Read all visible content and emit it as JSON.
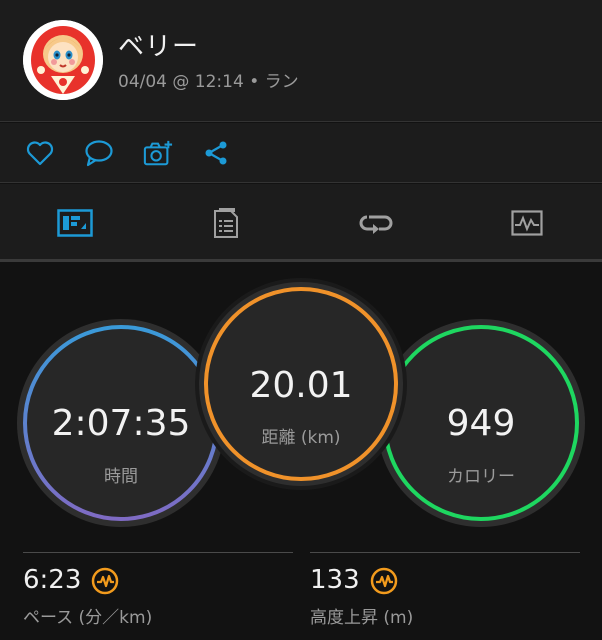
{
  "header": {
    "user_name": "ベリー",
    "activity_meta": "04/04 @ 12:14 • ラン"
  },
  "actions": [
    {
      "icon": "heart-icon"
    },
    {
      "icon": "comment-icon"
    },
    {
      "icon": "add-photo-icon"
    },
    {
      "icon": "share-icon"
    }
  ],
  "tabs": [
    {
      "icon": "stats-overview-icon",
      "active": true
    },
    {
      "icon": "details-list-icon",
      "active": false
    },
    {
      "icon": "laps-icon",
      "active": false
    },
    {
      "icon": "chart-icon",
      "active": false
    }
  ],
  "gauges": {
    "time": {
      "value": "2:07:35",
      "label": "時間"
    },
    "distance": {
      "value": "20.01",
      "label": "距離 (km)"
    },
    "calories": {
      "value": "949",
      "label": "カロリー"
    }
  },
  "stats": {
    "pace": {
      "value": "6:23",
      "label": "ペース (分／km)"
    },
    "elevation": {
      "value": "133",
      "label": "高度上昇 (m)"
    }
  },
  "colors": {
    "accent_blue": "#1c9ad6",
    "time_ring_top": "#3a9ad9",
    "time_ring_bottom": "#7f6bc4",
    "distance_ring": "#f0922a",
    "calories_ring": "#1ed760",
    "insight_orange": "#f29b1d"
  }
}
